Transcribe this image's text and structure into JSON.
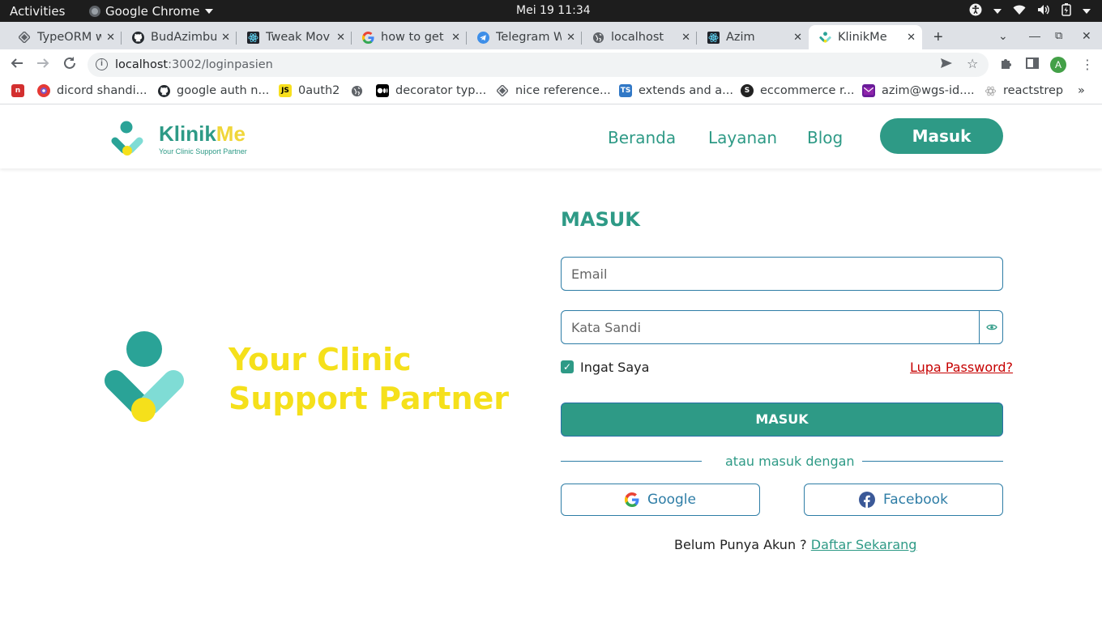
{
  "os_bar": {
    "activities": "Activities",
    "app_name": "Google Chrome",
    "clock": "Mei 19  11:34"
  },
  "tabs": [
    {
      "label": "TypeORM w",
      "icon": "typeorm-icon"
    },
    {
      "label": "BudAzimbu",
      "icon": "github-icon"
    },
    {
      "label": "Tweak Mov",
      "icon": "react-icon"
    },
    {
      "label": "how to get",
      "icon": "google-icon"
    },
    {
      "label": "Telegram W",
      "icon": "telegram-icon"
    },
    {
      "label": "localhost",
      "icon": "globe-icon"
    },
    {
      "label": "Azim",
      "icon": "react-icon"
    },
    {
      "label": "KlinikMe",
      "icon": "klinikme-icon"
    }
  ],
  "address": {
    "host": "localhost",
    "path": ":3002/loginpasien"
  },
  "bookmarks": [
    {
      "label": "",
      "icon": "bookmark-red-icon"
    },
    {
      "label": "dicord shandi...",
      "icon": "discord-icon"
    },
    {
      "label": "google auth n...",
      "icon": "github-icon"
    },
    {
      "label": "0auth2",
      "icon": "js-icon"
    },
    {
      "label": "",
      "icon": "globe-icon"
    },
    {
      "label": "decorator typ...",
      "icon": "medium-icon"
    },
    {
      "label": "nice reference...",
      "icon": "typeorm-icon"
    },
    {
      "label": "extends and a...",
      "icon": "ts-icon"
    },
    {
      "label": "eccommerce r...",
      "icon": "s-icon"
    },
    {
      "label": "azim@wgs-id....",
      "icon": "mail-icon"
    },
    {
      "label": "reactstrep",
      "icon": "react-icon"
    }
  ],
  "site": {
    "brand": {
      "name_a": "Klinik",
      "name_b": "Me",
      "tagline": "Your Clinic Support Partner"
    },
    "nav": [
      "Beranda",
      "Layanan",
      "Blog"
    ],
    "nav_button": "Masuk",
    "hero_line1": "Your Clinic",
    "hero_line2": "Support Partner"
  },
  "form": {
    "title": "MASUK",
    "email_placeholder": "Email",
    "password_placeholder": "Kata Sandi",
    "remember": "Ingat Saya",
    "remember_checked": true,
    "forgot": "Lupa Password?",
    "submit": "MASUK",
    "divider": "atau masuk dengan",
    "google": "Google",
    "facebook": "Facebook",
    "signup_prompt": "Belum Punya Akun ?",
    "signup_link": "Daftar Sekarang"
  },
  "colors": {
    "primary": "#2e9a86",
    "accent_yellow": "#f5e01b",
    "border_blue": "#2e7da6",
    "danger": "#c60000"
  }
}
